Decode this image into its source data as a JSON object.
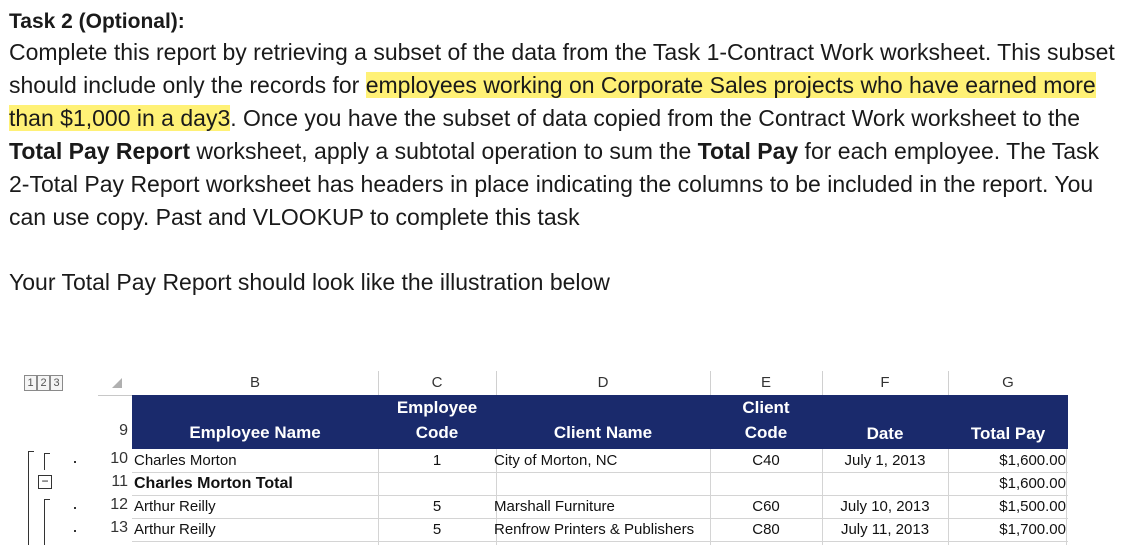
{
  "document": {
    "title": "Task 2 (Optional):",
    "paragraph": {
      "part1": "Complete this report by retrieving a subset of the data from the Task 1-Contract Work worksheet. This subset should include only the records for ",
      "highlight": "employees working on Corporate Sales projects who have earned more than $1,000 in a day3",
      "part2": ". Once you have the subset of data copied from the Contract Work worksheet to the ",
      "bold1": "Total Pay Report",
      "part3": " worksheet, apply a subtotal operation to sum the ",
      "bold2": "Total Pay",
      "part4": " for each employee. The Task 2-Total Pay Report worksheet has headers in place indicating the columns to be included in the report. You can use copy. Past and VLOOKUP to complete this task"
    },
    "illustration_caption": "Your Total Pay Report should look like the illustration below"
  },
  "sheet": {
    "outline_levels": [
      "1",
      "2",
      "3"
    ],
    "columns": [
      "B",
      "C",
      "D",
      "E",
      "F",
      "G"
    ],
    "header_row_number": "9",
    "headers": {
      "employee_name": "Employee Name",
      "employee_code_line1": "Employee",
      "employee_code_line2": "Code",
      "client_name": "Client Name",
      "client_code_line1": "Client",
      "client_code_line2": "Code",
      "date": "Date",
      "total_pay": "Total Pay"
    },
    "rows": [
      {
        "num": "10",
        "name": "Charles Morton",
        "emp_code": "1",
        "client": "City of Morton, NC",
        "client_code": "C40",
        "date": "July 1, 2013",
        "pay": "$1,600.00"
      },
      {
        "num": "11",
        "name": "Charles Morton Total",
        "emp_code": "",
        "client": "",
        "client_code": "",
        "date": "",
        "pay": "$1,600.00"
      },
      {
        "num": "12",
        "name": "Arthur Reilly",
        "emp_code": "5",
        "client": "Marshall Furniture",
        "client_code": "C60",
        "date": "July 10, 2013",
        "pay": "$1,500.00"
      },
      {
        "num": "13",
        "name": "Arthur Reilly",
        "emp_code": "5",
        "client": "Renfrow Printers & Publishers",
        "client_code": "C80",
        "date": "July 11, 2013",
        "pay": "$1,700.00"
      }
    ]
  }
}
